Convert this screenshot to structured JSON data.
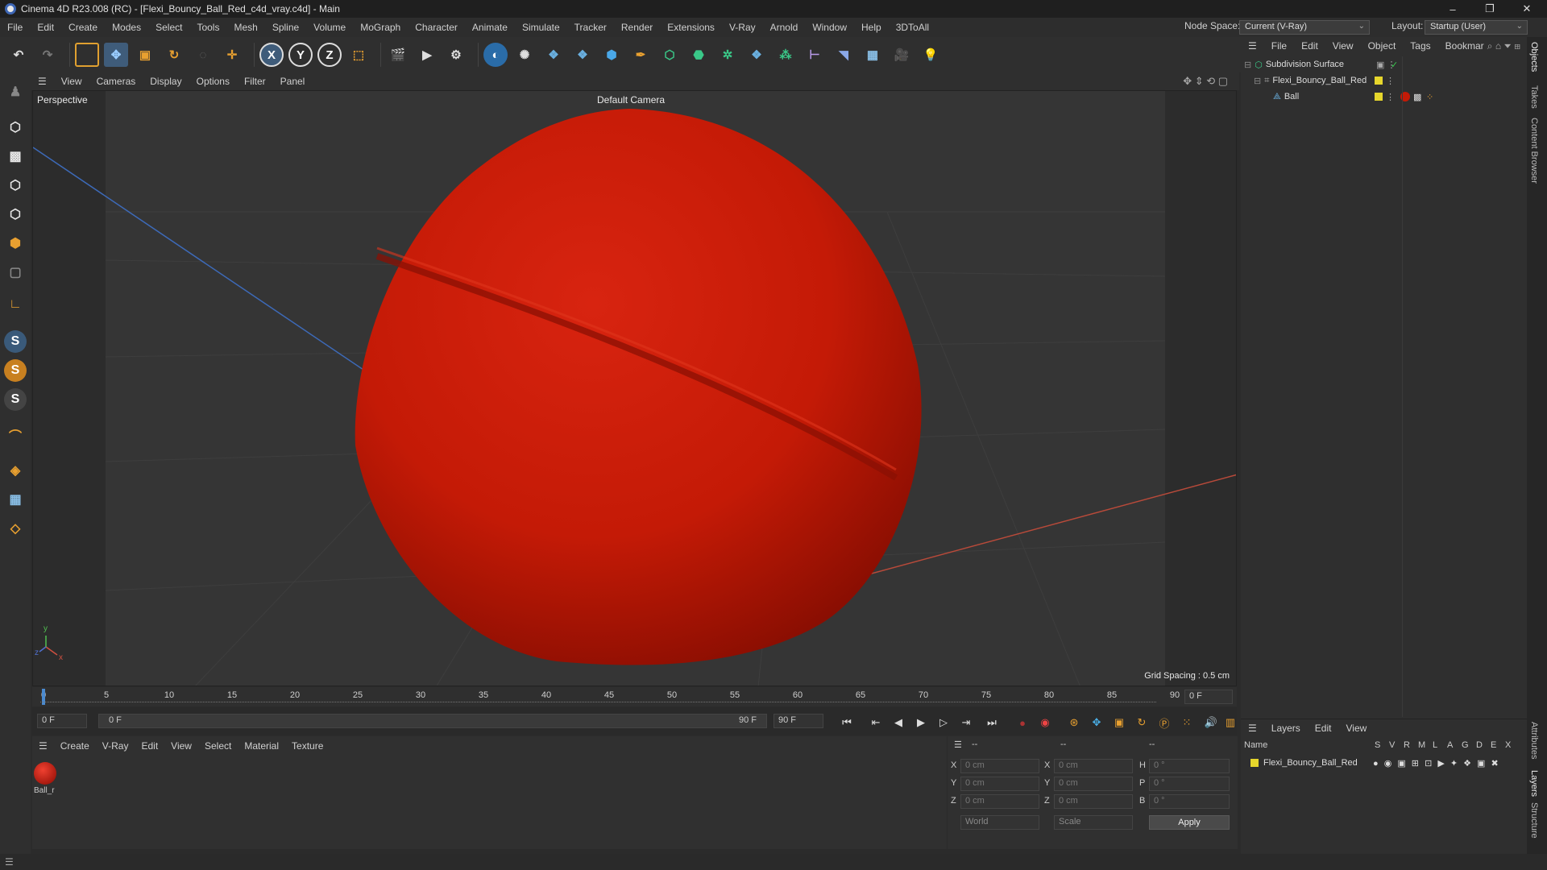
{
  "window": {
    "title": "Cinema 4D R23.008 (RC) - [Flexi_Bouncy_Ball_Red_c4d_vray.c4d] - Main",
    "minimize": "–",
    "maximize": "❐",
    "close": "✕"
  },
  "menu": [
    "File",
    "Edit",
    "Create",
    "Modes",
    "Select",
    "Tools",
    "Mesh",
    "Spline",
    "Volume",
    "MoGraph",
    "Character",
    "Animate",
    "Simulate",
    "Tracker",
    "Render",
    "Extensions",
    "V-Ray",
    "Arnold",
    "Window",
    "Help",
    "3DToAll"
  ],
  "node_space": {
    "label": "Node Space:",
    "value": "Current (V-Ray)"
  },
  "layout": {
    "label": "Layout:",
    "value": "Startup (User)"
  },
  "toolbar": {
    "undo": "↶",
    "redo": "↷",
    "axis_x": "X",
    "axis_y": "Y",
    "axis_z": "Z"
  },
  "viewport_menu": [
    "View",
    "Cameras",
    "Display",
    "Options",
    "Filter",
    "Panel"
  ],
  "viewport": {
    "name": "Perspective",
    "camera": "Default Camera",
    "grid_spacing": "Grid Spacing : 0.5 cm",
    "axis_x": "x",
    "axis_y": "y",
    "axis_z": "z"
  },
  "timeline": {
    "ticks": [
      "0",
      "5",
      "10",
      "15",
      "20",
      "25",
      "30",
      "35",
      "40",
      "45",
      "50",
      "55",
      "60",
      "65",
      "70",
      "75",
      "80",
      "85",
      "90"
    ],
    "current_frame": "0 F"
  },
  "transport": {
    "start_frame": "0 F",
    "range_start": "0 F",
    "range_end": "90 F",
    "end_frame": "90 F"
  },
  "material_menu": [
    "Create",
    "V-Ray",
    "Edit",
    "View",
    "Select",
    "Material",
    "Texture"
  ],
  "material": {
    "name": "Ball_r"
  },
  "attributes": {
    "header1": "--",
    "header2": "--",
    "header3": "--",
    "x_label": "X",
    "y_label": "Y",
    "z_label": "Z",
    "h_label": "H",
    "p_label": "P",
    "b_label": "B",
    "pos_x": "0 cm",
    "pos_y": "0 cm",
    "pos_z": "0 cm",
    "size_x": "0 cm",
    "size_y": "0 cm",
    "size_z": "0 cm",
    "rot_h": "0 °",
    "rot_p": "0 °",
    "rot_b": "0 °",
    "coord_mode": "World",
    "size_mode": "Scale",
    "apply": "Apply"
  },
  "objects_menu": [
    "File",
    "Edit",
    "View",
    "Object",
    "Tags",
    "Bookmar"
  ],
  "objects": [
    {
      "name": "Subdivision Surface",
      "indent": 0
    },
    {
      "name": "Flexi_Bouncy_Ball_Red",
      "indent": 1
    },
    {
      "name": "Ball",
      "indent": 2
    }
  ],
  "layers_menu": [
    "Layers",
    "Edit",
    "View"
  ],
  "layers": {
    "columns": [
      "Name",
      "S",
      "V",
      "R",
      "M",
      "L",
      "A",
      "G",
      "D",
      "E",
      "X"
    ],
    "rows": [
      {
        "name": "Flexi_Bouncy_Ball_Red"
      }
    ]
  },
  "side_tabs": [
    "Objects",
    "Takes",
    "Content Browser",
    "Attributes",
    "Layers",
    "Structure"
  ],
  "colors": {
    "ball": "#cc1a08",
    "accent": "#3d66b5",
    "layer": "#e6d62c"
  }
}
